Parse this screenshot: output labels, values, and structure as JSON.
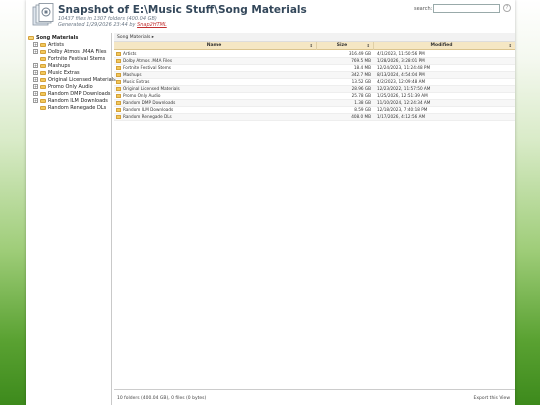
{
  "header": {
    "title": "Snapshot of E:\\Music Stuff\\Song Materials",
    "subtitle_counts": "10437 files in 1307 folders (400.04 GB)",
    "generated_prefix": "Generated 1/29/2026 23:44 by ",
    "generated_link": "Snap2HTML",
    "search_label": "search:",
    "search_value": "",
    "help_label": "?"
  },
  "sidebar": {
    "root": "Song Materials",
    "items": [
      {
        "label": "Artists",
        "toggle": "+"
      },
      {
        "label": "Dolby Atmos .M4A Files",
        "toggle": "+"
      },
      {
        "label": "Fortnite Festival Stems",
        "toggle": ""
      },
      {
        "label": "Mashups",
        "toggle": "+"
      },
      {
        "label": "Music Extras",
        "toggle": "+"
      },
      {
        "label": "Original Licensed Materials",
        "toggle": "+"
      },
      {
        "label": "Promo Only Audio",
        "toggle": "+"
      },
      {
        "label": "Random DMP Downloads",
        "toggle": "+"
      },
      {
        "label": "Random ILM Downloads",
        "toggle": "+"
      },
      {
        "label": "Random Renegade DLs",
        "toggle": ""
      }
    ]
  },
  "breadcrumb": "Song Materials ▸",
  "table": {
    "headers": {
      "name": "Name",
      "size": "Size",
      "modified": "Modified",
      "sort_icon": "⇕"
    },
    "rows": [
      {
        "name": "Artists",
        "size": "316.49 GB",
        "modified": "4/1/2023, 11:50:56 PM"
      },
      {
        "name": "Dolby Atmos .M4A Files",
        "size": "769.5 MB",
        "modified": "1/28/2026, 3:28:01 PM"
      },
      {
        "name": "Fortnite Festival Stems",
        "size": "18.4 MB",
        "modified": "12/24/2023, 11:24:48 PM"
      },
      {
        "name": "Mashups",
        "size": "342.7 MB",
        "modified": "8/13/2024, 4:54:04 PM"
      },
      {
        "name": "Music Extras",
        "size": "13.52 GB",
        "modified": "4/2/2023, 12:09:48 AM"
      },
      {
        "name": "Original Licensed Materials",
        "size": "28.96 GB",
        "modified": "12/23/2022, 11:57:50 AM"
      },
      {
        "name": "Promo Only Audio",
        "size": "25.78 GB",
        "modified": "1/25/2026, 12:51:39 AM"
      },
      {
        "name": "Random DMP Downloads",
        "size": "1.38 GB",
        "modified": "11/10/2024, 12:24:34 AM"
      },
      {
        "name": "Random ILM Downloads",
        "size": "8.59 GB",
        "modified": "12/18/2023, 7:40:18 PM"
      },
      {
        "name": "Random Renegade DLs",
        "size": "408.0 MB",
        "modified": "1/17/2026, 4:12:56 AM"
      }
    ]
  },
  "footer": {
    "status": "10 folders (400.04 GB), 0 files (0 bytes)",
    "export": "Export this View"
  },
  "colors": {
    "accent_header": "#f5e7c4",
    "folder": "#f2c85b",
    "background_green": "#5aa232"
  }
}
